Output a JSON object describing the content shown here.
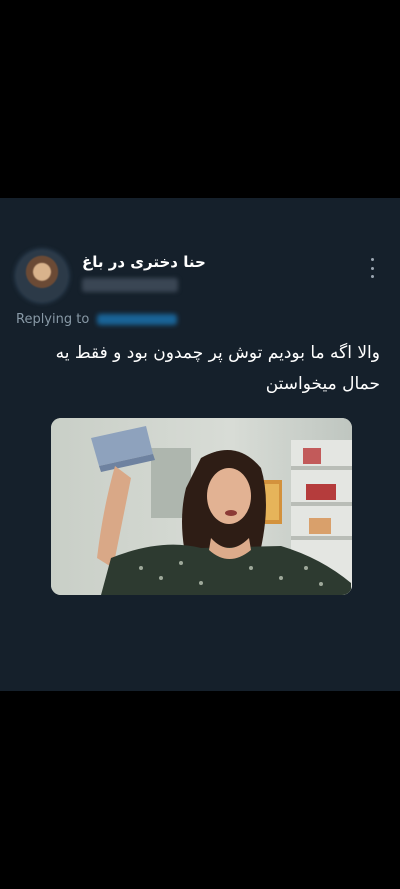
{
  "tweet": {
    "display_name": "حنا دختری در باغ",
    "replying_to_label": "Replying to",
    "text": "والا اگه ما بودیم توش پر چمدون بود و فقط یه حمال میخواستن"
  },
  "colors": {
    "background": "#000000",
    "card": "#15202b",
    "text": "#e7e9ea",
    "muted": "#8899a6",
    "accent": "#1d9bf0"
  },
  "icons": {
    "more": "more-vertical-icon"
  }
}
